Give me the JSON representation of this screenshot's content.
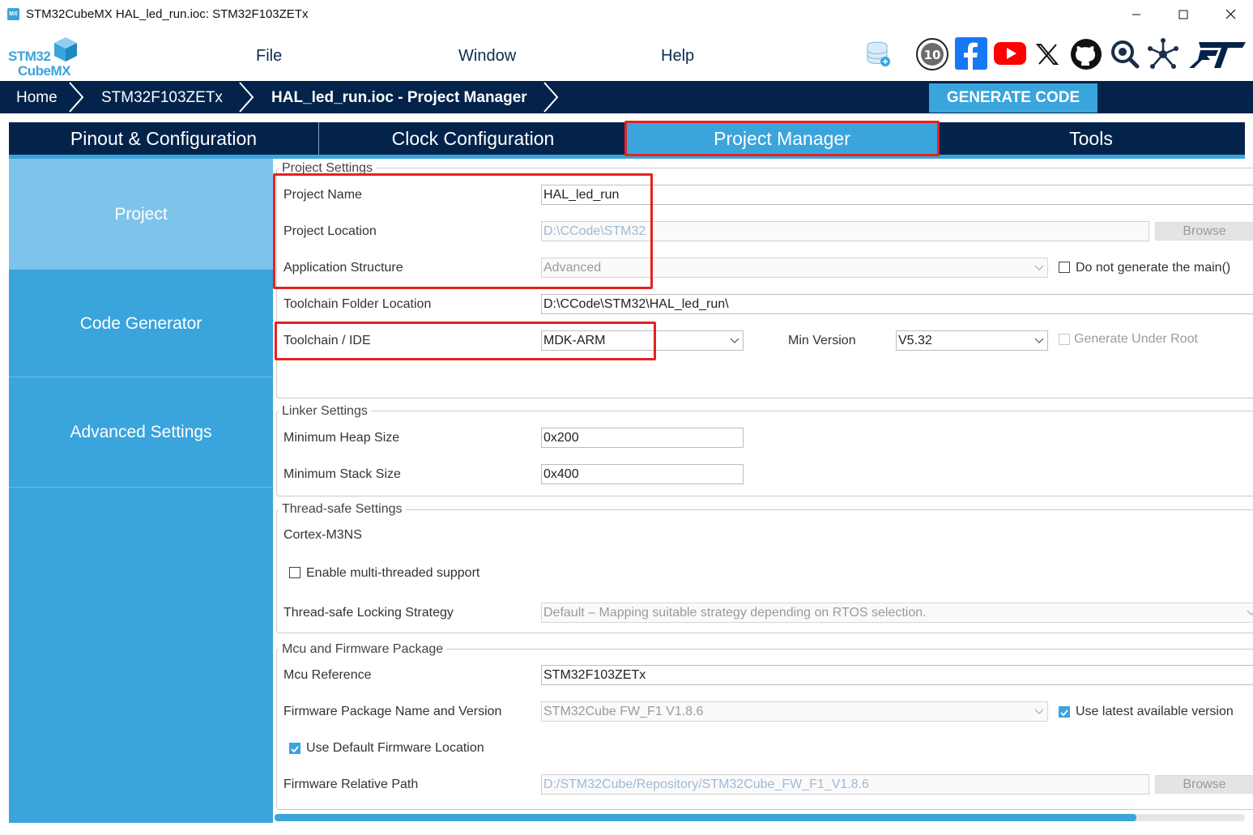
{
  "window": {
    "app_icon": "MX",
    "title": "STM32CubeMX HAL_led_run.ioc: STM32F103ZETx",
    "controls": [
      "minimize-icon",
      "maximize-icon",
      "close-icon"
    ]
  },
  "logo": {
    "line1": "STM32",
    "line2": "CubeMX"
  },
  "menu": {
    "file": "File",
    "window": "Window",
    "help": "Help"
  },
  "toolbar_icons": [
    "database-update-icon",
    "anniversary-10-icon",
    "facebook-icon",
    "youtube-icon",
    "x-icon",
    "github-icon",
    "search-community-icon",
    "network-icon",
    "st-logo-icon"
  ],
  "breadcrumb": {
    "home": "Home",
    "device": "STM32F103ZETx",
    "current": "HAL_led_run.ioc - Project Manager"
  },
  "generate_code": "GENERATE CODE",
  "tabs": [
    {
      "label": "Pinout & Configuration",
      "active": false
    },
    {
      "label": "Clock Configuration",
      "active": false
    },
    {
      "label": "Project Manager",
      "active": true
    },
    {
      "label": "Tools",
      "active": false
    }
  ],
  "sidebar": {
    "items": [
      {
        "label": "Project",
        "active": true
      },
      {
        "label": "Code Generator",
        "active": false
      },
      {
        "label": "Advanced Settings",
        "active": false
      }
    ]
  },
  "project_settings": {
    "title": "Project Settings",
    "project_name_label": "Project Name",
    "project_name_value": "HAL_led_run",
    "project_location_label": "Project Location",
    "project_location_value": "D:\\CCode\\STM32",
    "browse_label": "Browse",
    "app_structure_label": "Application Structure",
    "app_structure_value": "Advanced",
    "no_main_label": "Do not generate the main()",
    "no_main_checked": false,
    "toolchain_folder_label": "Toolchain Folder Location",
    "toolchain_folder_value": "D:\\CCode\\STM32\\HAL_led_run\\",
    "toolchain_ide_label": "Toolchain / IDE",
    "toolchain_ide_value": "MDK-ARM",
    "min_version_label": "Min Version",
    "min_version_value": "V5.32",
    "gen_under_root_label": "Generate Under Root",
    "gen_under_root_checked": false
  },
  "linker_settings": {
    "title": "Linker Settings",
    "heap_label": "Minimum Heap Size",
    "heap_value": "0x200",
    "stack_label": "Minimum Stack Size",
    "stack_value": "0x400"
  },
  "thread_safe": {
    "title": "Thread-safe Settings",
    "core": "Cortex-M3NS",
    "multithread_label": "Enable multi-threaded support",
    "multithread_checked": false,
    "strategy_label": "Thread-safe Locking Strategy",
    "strategy_value": "Default – Mapping suitable strategy depending on RTOS selection."
  },
  "mcu_firmware": {
    "title": "Mcu and Firmware Package",
    "mcu_ref_label": "Mcu Reference",
    "mcu_ref_value": "STM32F103ZETx",
    "fw_pkg_label": "Firmware Package Name and Version",
    "fw_pkg_value": "STM32Cube FW_F1 V1.8.6",
    "use_latest_label": "Use latest available version",
    "use_latest_checked": true,
    "use_default_fw_label": "Use Default Firmware Location",
    "use_default_fw_checked": true,
    "fw_path_label": "Firmware Relative Path",
    "fw_path_value": "D:/STM32Cube/Repository/STM32Cube_FW_F1_V1.8.6",
    "browse_label": "Browse"
  },
  "colors": {
    "navy": "#03234b",
    "accent": "#3aa4dc",
    "sidebar_active": "#7dc4ea",
    "highlight_red": "#e52220"
  }
}
